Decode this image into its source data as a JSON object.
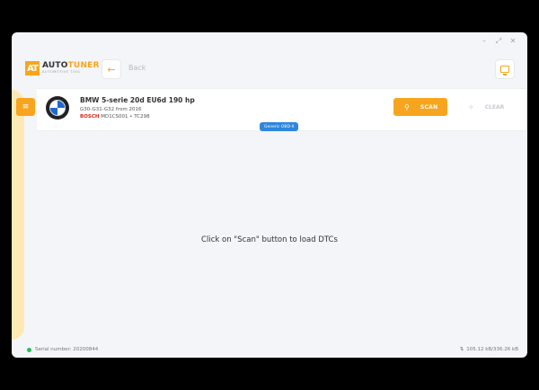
{
  "window": {
    "controls": {
      "minimize": "–",
      "maximize": "⤢",
      "close": "✕"
    }
  },
  "header": {
    "logo_badge": "AT",
    "logo_name_a": "AUTO",
    "logo_name_b": "TUNER",
    "logo_sub": "AUTOMOTIVE TOOL",
    "back_icon": "←",
    "back_label": "Back",
    "top_right_icon": "monitor-icon"
  },
  "sidebar": {
    "menu_icon": "≡"
  },
  "vehicle": {
    "title": "BMW 5-serie 20d EU6d 190 hp",
    "subtitle": "G30-G31-G32 from 2016",
    "ecu_brand": "BOSCH",
    "ecu_detail": "MD1CS001 • TC298",
    "badge": "Generic OBD-II"
  },
  "actions": {
    "scan_icon": "⚲",
    "scan_label": "SCAN",
    "clear_icon": "✧",
    "clear_label": "CLEAR"
  },
  "main": {
    "empty_message": "Click on \"Scan\" button  to load DTCs"
  },
  "footer": {
    "serial": "Serial number: 20200844",
    "transfer_icon": "⇅",
    "transfer": "105.12 kB/336.26 kB"
  },
  "colors": {
    "accent": "#f7a51e",
    "badge": "#2e86de",
    "status_ok": "#26c05a",
    "bosch": "#e2211c"
  }
}
